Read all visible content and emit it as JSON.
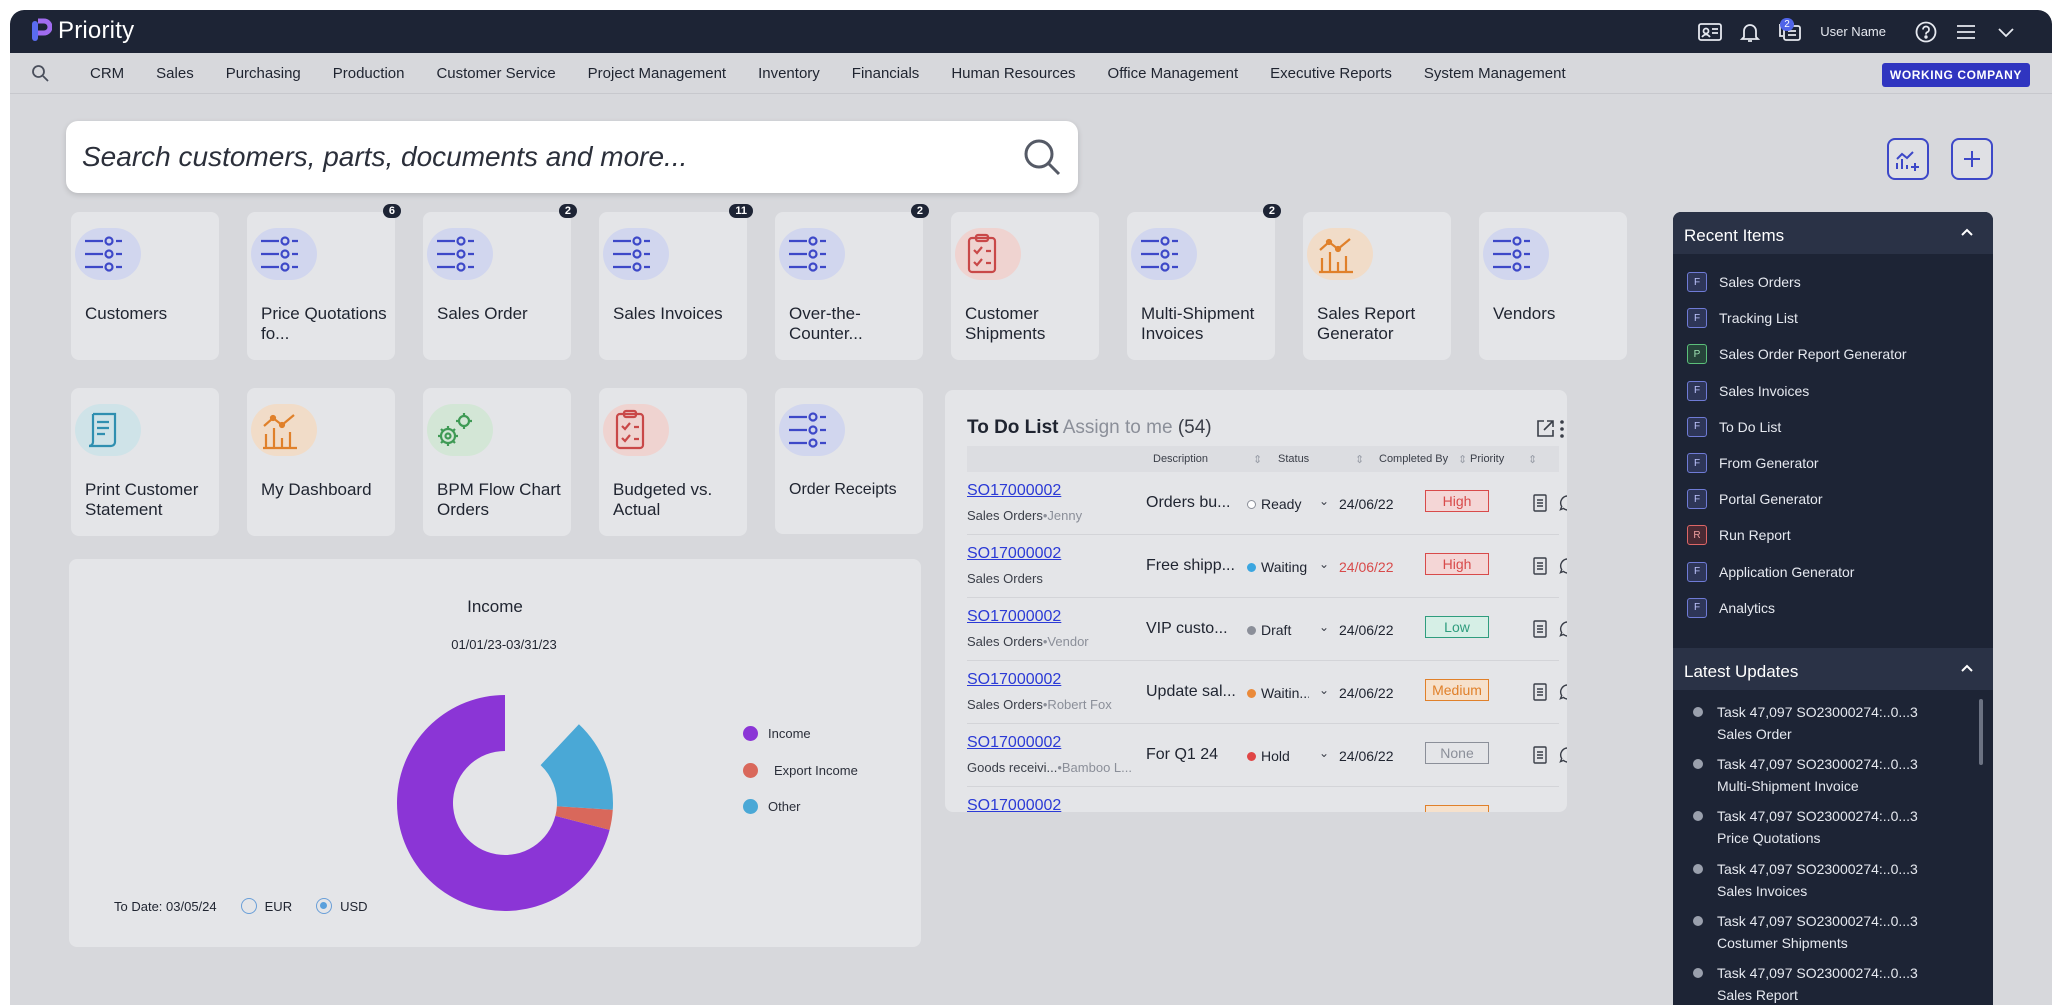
{
  "app": {
    "name": "Priority",
    "user_name": "User Name",
    "messages_badge": "2",
    "working_company": "WORKING COMPANY"
  },
  "menu": [
    "CRM",
    "Sales",
    "Purchasing",
    "Production",
    "Customer Service",
    "Project Management",
    "Inventory",
    "Financials",
    "Human Resources",
    "Office Management",
    "Executive Reports",
    "System Management"
  ],
  "search": {
    "placeholder": "Search customers, parts, documents and more..."
  },
  "cards": [
    {
      "label": "Customers",
      "icon": "list-icon",
      "badge": ""
    },
    {
      "label": "Price Quotations fo...",
      "icon": "list-icon",
      "badge": "6"
    },
    {
      "label": "Sales Order",
      "icon": "list-icon",
      "badge": "2"
    },
    {
      "label": "Sales Invoices",
      "icon": "list-icon",
      "badge": "11"
    },
    {
      "label": "Over-the-Counter...",
      "icon": "list-icon",
      "badge": "2"
    },
    {
      "label": "Customer Shipments",
      "icon": "clipboard-icon",
      "badge": ""
    },
    {
      "label": "Multi-Shipment Invoices",
      "icon": "list-icon",
      "badge": "2"
    },
    {
      "label": "Sales Report Generator",
      "icon": "chart-icon",
      "badge": ""
    },
    {
      "label": "Vendors",
      "icon": "list-icon",
      "badge": ""
    },
    {
      "label": "Print Customer Statement",
      "icon": "document-icon",
      "badge": ""
    },
    {
      "label": "My Dashboard",
      "icon": "chart-icon",
      "badge": ""
    },
    {
      "label": "BPM Flow Chart Orders",
      "icon": "gears-icon",
      "badge": ""
    },
    {
      "label": "Budgeted vs. Actual",
      "icon": "clipboard-icon",
      "badge": ""
    },
    {
      "label": "Order Receipts",
      "icon": "list-icon",
      "badge": ""
    }
  ],
  "income": {
    "title": "Income",
    "range": "01/01/23-03/31/23",
    "to_date": "To Date: 03/05/24",
    "currencies": [
      "EUR",
      "USD"
    ],
    "selected_currency": "USD",
    "colors": {
      "income": "#8b35d6",
      "export": "#d9685b",
      "other": "#4aa8d6"
    }
  },
  "chart_data": {
    "type": "pie",
    "categories": [
      "Income",
      "Export Income",
      "Other"
    ],
    "values": [
      71,
      3,
      14
    ],
    "legend_position": "right"
  },
  "todo": {
    "title": "To Do List",
    "assign": "Assign to me",
    "count": "(54)",
    "columns": [
      "Description",
      "Status",
      "Completed By",
      "Priority"
    ],
    "rows": [
      {
        "number": "SO17000002",
        "type": "Sales Orders",
        "person": "•Jenny",
        "description": "Orders bu...",
        "status": "Ready",
        "status_color": "#ffffff",
        "date": "24/06/22",
        "date_color": "#1f2430",
        "priority": "High",
        "prio_color": "#d84a4a",
        "prio_bg": "#f4d6d6"
      },
      {
        "number": "SO17000002",
        "type": "Sales Orders",
        "person": "",
        "description": "Free shipp...",
        "status": "Waiting",
        "status_color": "#3ba6e0",
        "date": "24/06/22",
        "date_color": "#d84a4a",
        "priority": "High",
        "prio_color": "#d84a4a",
        "prio_bg": "#f4d6d6"
      },
      {
        "number": "SO17000002",
        "type": "Sales Orders",
        "person": "•Vendor",
        "description": "VIP custo...",
        "status": "Draft",
        "status_color": "#8b8f99",
        "date": "24/06/22",
        "date_color": "#1f2430",
        "priority": "Low",
        "prio_color": "#2f9d7e",
        "prio_bg": "#d6efe6"
      },
      {
        "number": "SO17000002",
        "type": "Sales Orders",
        "person": "•Robert Fox",
        "description": "Update sal...",
        "status": "Waitin...",
        "status_color": "#ea8a3a",
        "date": "24/06/22",
        "date_color": "#1f2430",
        "priority": "Medium",
        "prio_color": "#e0802a",
        "prio_bg": "#f6e1cc"
      },
      {
        "number": "SO17000002",
        "type": "Goods receivi...",
        "person": "•Bamboo L...",
        "description": "For Q1 24",
        "status": "Hold",
        "status_color": "#e04646",
        "date": "24/06/22",
        "date_color": "#1f2430",
        "priority": "None",
        "prio_color": "#8b8f99",
        "prio_bg": "#e4e5e8"
      },
      {
        "number": "SO17000002",
        "type": "",
        "person": "",
        "description": "",
        "status": "",
        "status_color": "#e4e5e8",
        "date": "",
        "date_color": "#1f2430",
        "priority": "",
        "prio_color": "#e0802a",
        "prio_bg": "#f6e1cc"
      }
    ]
  },
  "recent": {
    "title": "Recent Items",
    "items": [
      {
        "tag": "F",
        "label": "Sales Orders"
      },
      {
        "tag": "F",
        "label": "Tracking List"
      },
      {
        "tag": "P",
        "label": "Sales Order Report Generator"
      },
      {
        "tag": "F",
        "label": "Sales Invoices"
      },
      {
        "tag": "F",
        "label": "To Do List"
      },
      {
        "tag": "F",
        "label": "From Generator"
      },
      {
        "tag": "F",
        "label": "Portal Generator"
      },
      {
        "tag": "R",
        "label": "Run Report"
      },
      {
        "tag": "F",
        "label": "Application Generator"
      },
      {
        "tag": "F",
        "label": "Analytics"
      }
    ]
  },
  "updates": {
    "title": "Latest Updates",
    "items": [
      {
        "line1": "Task 47,097 SO23000274:..0...3",
        "line2": "Sales Order"
      },
      {
        "line1": "Task 47,097 SO23000274:..0...3",
        "line2": "Multi-Shipment Invoice"
      },
      {
        "line1": "Task 47,097 SO23000274:..0...3",
        "line2": "Price Quotations"
      },
      {
        "line1": "Task 47,097 SO23000274:..0...3",
        "line2": "Sales Invoices"
      },
      {
        "line1": "Task 47,097 SO23000274:..0...3",
        "line2": "Costumer Shipments"
      },
      {
        "line1": "Task 47,097 SO23000274:..0...3",
        "line2": "Sales Report"
      }
    ]
  }
}
